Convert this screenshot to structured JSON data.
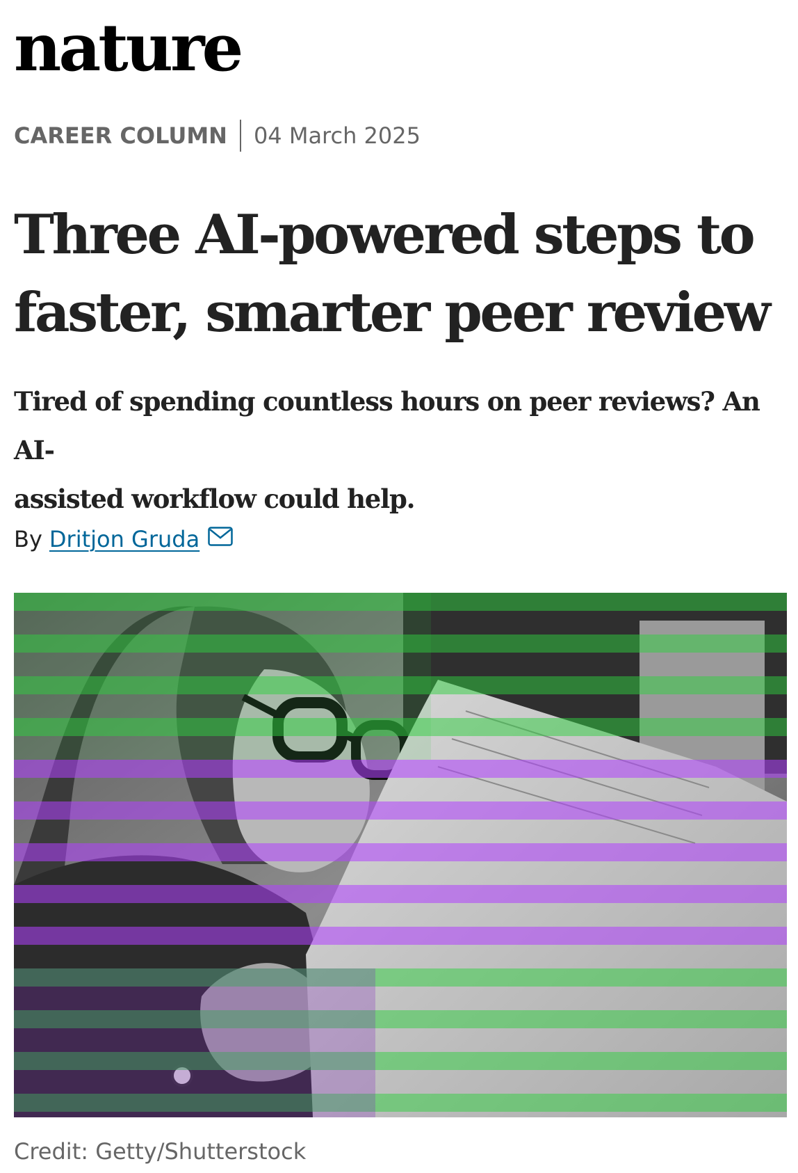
{
  "site": {
    "logo": "nature"
  },
  "article": {
    "type": "CAREER COLUMN",
    "date": "04 March 2025",
    "title_line1": "Three AI-powered steps to",
    "title_line2": "faster, smarter peer review",
    "standfirst_line1": "Tired of spending countless hours on peer reviews? An AI-",
    "standfirst_line2": "assisted workflow could help.",
    "byline_prefix": "By",
    "author": "Dritjon Gruda",
    "author_contact_icon": "mail-icon"
  },
  "figure": {
    "image_description_icon": "photo-woman-reading-paper",
    "credit": "Credit: Getty/Shutterstock",
    "colors": {
      "purple": "#a020f0",
      "green": "#22c03a"
    }
  },
  "colors": {
    "link": "#006699",
    "meta": "#666666",
    "text": "#222222"
  }
}
